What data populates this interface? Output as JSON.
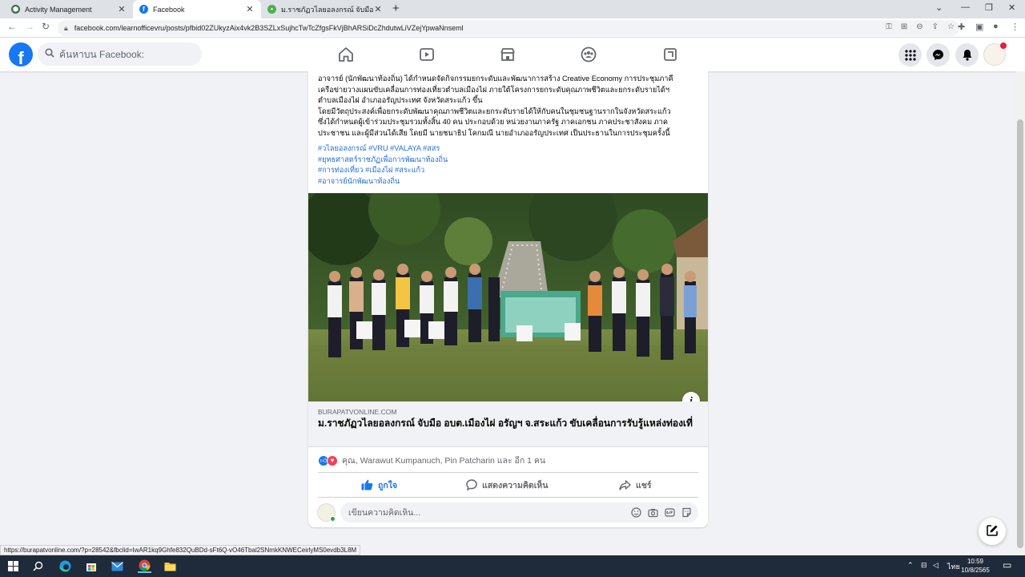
{
  "browser": {
    "tabs": [
      {
        "title": "Activity Management",
        "active": false,
        "icon": "shield-icon"
      },
      {
        "title": "Facebook",
        "active": true,
        "icon": "facebook-icon"
      },
      {
        "title": "ม.ราชภัฏวไลยอลงกรณ์ จับมือ อบต.เมือ...",
        "active": false,
        "icon": "site-leaf-icon"
      }
    ],
    "url": "facebook.com/learnofficevru/posts/pfbid02ZUkyzAix4vk2B3SZLxSujhcTwTcZfgsFkVjBhARSiDcZhdutwLiVZejYpwaNnseml",
    "status_url": "https://burapatvonline.com/?p=28542&fbclid=IwAR1kq9Ghfe832QuBDd-sFt6Q-vO46Tbal2SNmkKNWECeirlyMS0evdb3L8M"
  },
  "facebook": {
    "search_placeholder": "ค้นหาบน Facebook:",
    "brand_color": "#1877f2"
  },
  "post": {
    "text_lines": [
      "อาจารย์ (นักพัฒนาท้องถิ่น) ได้กำหนดจัดกิจกรรมยกระดับและพัฒนาการสร้าง Creative Economy การประชุมภาคี",
      "เครือข่ายวางแผนขับเคลื่อนการท่องเที่ยวตำบลเมืองไผ่ ภายใต้โครงการยกระดับคุณภาพชีวิตและยกระดับรายได้ฯ",
      "ตำบลเมืองไผ่ อำเภออรัญประเทศ จังหวัดสระแก้ว ขึ้น",
      "โดยมีวัตถุประสงค์เพื่อยกระดับพัฒนาคุณภาพชีวิตและยกระดับรายได้ให้กับคนในชุมชนฐานรากในจังหวัดสระแก้ว",
      "ซึ่งได้กำหนดผู้เข้าร่วมประชุมรวมทั้งสิ้น 40 คน ประกอบด้วย หน่วยงานภาครัฐ ภาคเอกชน ภาคประชาสังคม ภาค",
      "ประชาชน และผู้มีส่วนได้เสีย โดยมี นายชนาธิป โคกมณี นายอำเภออรัญประเทศ เป็นประธานในการประชุมครั้งนี้"
    ],
    "hashtag_lines": [
      "#วไลยอลงกรณ์ #VRU #VALAYA #สสร",
      "#ยุทธศาสตร์ราชภัฏเพื่อการพัฒนาท้องถิ่น",
      "#การท่องเที่ยว #เมืองไผ่ #สระแก้ว",
      "#อาจารย์นักพัฒนาท้องถิ่น"
    ],
    "link_domain": "BURAPATVONLINE.COM",
    "link_title": "ม.ราชภัฏวไลยอลงกรณ์ จับมือ อบต.เมืองไผ่ อรัญฯ จ.สระแก้ว ขับเคลื่อนการรับรู้แหล่งท่องเที่",
    "reactions_text": "คุณ, Warawut Kumpanuch, Pin Patcharin และ อีก 1 คน",
    "actions": {
      "like": "ถูกใจ",
      "comment": "แสดงความคิดเห็น",
      "share": "แชร์"
    },
    "comment_placeholder": "เขียนความคิดเห็น..."
  },
  "taskbar": {
    "language": "ไทย",
    "time": "10:59",
    "date": "10/8/2565"
  }
}
